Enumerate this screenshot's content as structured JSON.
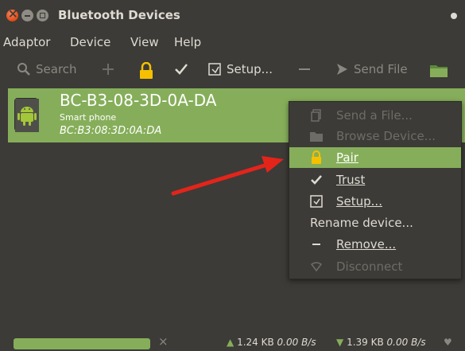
{
  "window": {
    "title": "Bluetooth Devices"
  },
  "menubar": [
    "Adaptor",
    "Device",
    "View",
    "Help"
  ],
  "toolbar": {
    "search": "Search",
    "setup": "Setup...",
    "send_file": "Send File",
    "icons": [
      "search-icon",
      "plus-icon",
      "lock-icon",
      "check-icon",
      "setup-icon",
      "minus-icon",
      "send-icon",
      "folder-icon"
    ]
  },
  "device": {
    "name": "BC-B3-08-3D-0A-DA",
    "type": "Smart phone",
    "address": "BC:B3:08:3D:0A:DA",
    "icon": "android-icon"
  },
  "context_menu": {
    "send_file": "Send a File...",
    "browse": "Browse Device...",
    "pair": "Pair",
    "trust": "Trust",
    "setup": "Setup...",
    "rename": "Rename device...",
    "remove": "Remove...",
    "disconnect": "Disconnect"
  },
  "status": {
    "upload_amount": "1.24 KB",
    "upload_rate": "0.00 B/s",
    "download_amount": "1.39 KB",
    "download_rate": "0.00 B/s",
    "progress": 1.0
  },
  "colors": {
    "accent": "#86ae5a",
    "background": "#3c3b37",
    "arrow": "#e3241b"
  }
}
